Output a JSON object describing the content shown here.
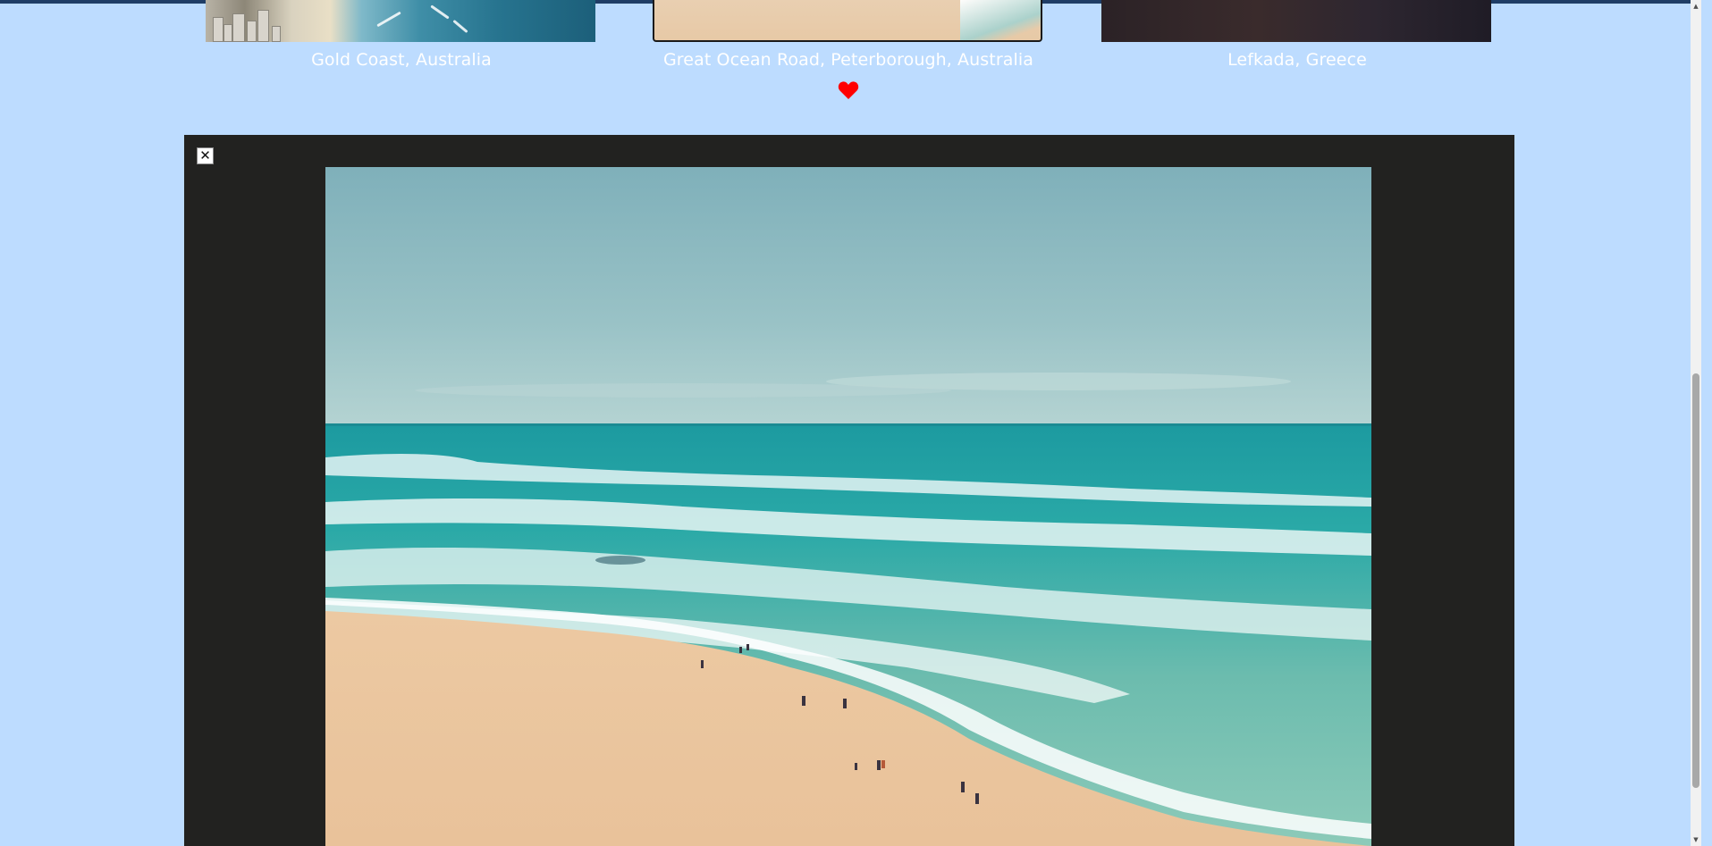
{
  "gallery": {
    "items": [
      {
        "caption": "Gold Coast, Australia",
        "favorited": false
      },
      {
        "caption": "Great Ocean Road, Peterborough, Australia",
        "favorited": true
      },
      {
        "caption": "Lefkada, Greece",
        "favorited": false
      }
    ]
  },
  "icons": {
    "favorite": "heart-icon",
    "close": "close-icon",
    "scroll_up": "arrow-up-icon",
    "scroll_down": "arrow-down-icon"
  },
  "modal": {
    "close_label": "✕",
    "background_color": "#222220"
  },
  "scrollbar": {
    "up_glyph": "▲",
    "down_glyph": "▼"
  },
  "colors": {
    "page_background": "#bddcff",
    "caption_text": "#ffffff",
    "heart": "#ff0000"
  }
}
